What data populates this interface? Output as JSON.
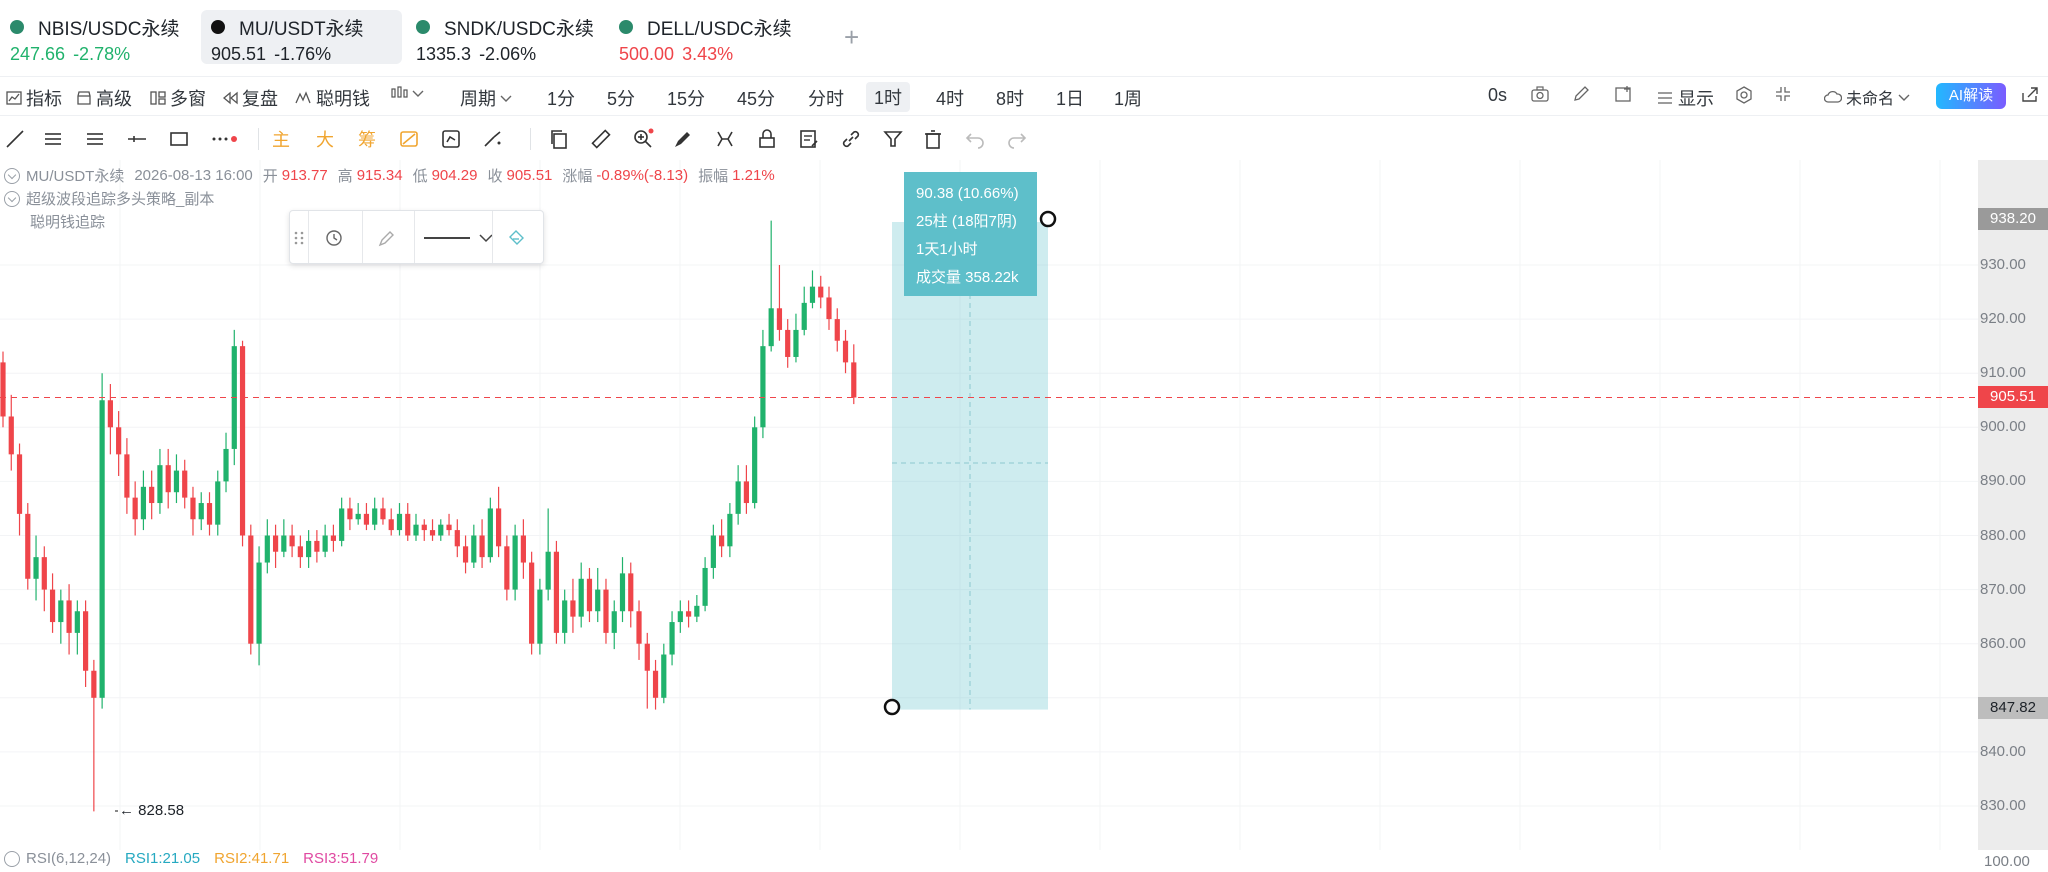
{
  "tabs": [
    {
      "symbol": "NBIS/USDC永续",
      "price": "247.66",
      "change": "-2.78%",
      "price_color": "up",
      "change_color": "up"
    },
    {
      "symbol": "MU/USDT永续",
      "price": "905.51",
      "change": "-1.76%",
      "price_color": "dark",
      "change_color": "dark"
    },
    {
      "symbol": "SNDK/USDC永续",
      "price": "1335.3",
      "change": "-2.06%",
      "price_color": "dark",
      "change_color": "dark"
    },
    {
      "symbol": "DELL/USDC永续",
      "price": "500.00",
      "change": "3.43%",
      "price_color": "down",
      "change_color": "down"
    }
  ],
  "add_tab_label": "+",
  "toolbar": {
    "indicators": "指标",
    "advanced": "高级",
    "multi_window": "多窗",
    "replay": "复盘",
    "smart_money": "聪明钱",
    "period": "周期",
    "intervals": [
      "1分",
      "5分",
      "15分",
      "45分",
      "分时",
      "1时",
      "4时",
      "8时",
      "1日",
      "1周"
    ],
    "selected_interval": "1时",
    "timer": "0s",
    "display": "显示",
    "layout_name": "未命名",
    "ai_label": "AI解读"
  },
  "legend": {
    "symbol": "MU/USDT永续",
    "datetime": "2026-08-13 16:00",
    "open_label": "开",
    "open": "913.77",
    "high_label": "高",
    "high": "915.34",
    "low_label": "低",
    "low": "904.29",
    "close_label": "收",
    "close": "905.51",
    "change_label": "涨幅",
    "change": "-0.89%(-8.13)",
    "amplitude_label": "振幅",
    "amplitude": "1.21%",
    "strategy": "超级波段追踪多头策略_副本",
    "indicator2": "聪明钱追踪"
  },
  "price_axis": {
    "labels": [
      "930.00",
      "920.00",
      "910.00",
      "900.00",
      "890.00",
      "880.00",
      "870.00",
      "860.00",
      "840.00",
      "830.00"
    ],
    "top_tag": "938.20",
    "current_tag": "905.51",
    "bottom_tag": "847.82",
    "rsi_scale": "100.00"
  },
  "measure": {
    "line1": "90.38 (10.66%)",
    "line2": "25柱 (18阳7阴)",
    "line3": "1天1小时",
    "line4": "成交量 358.22k"
  },
  "low_marker": "← 828.58",
  "rsi": {
    "name": "RSI(6,12,24)",
    "rsi1": "RSI1:21.05",
    "rsi2": "RSI2:41.71",
    "rsi3": "RSI3:51.79"
  },
  "colors": {
    "up": "#20b26c",
    "down": "#ef454a",
    "measure": "#5ebfca",
    "accent": "#f0a530"
  },
  "chart_data": {
    "type": "candlestick",
    "interval": "1时",
    "y_range": [
      825,
      945
    ],
    "current_price": 905.51,
    "measure_range": {
      "from": 847.82,
      "to": 938.2
    },
    "candles": [
      [
        912,
        902,
        914,
        900
      ],
      [
        902,
        895,
        906,
        892
      ],
      [
        895,
        884,
        897,
        880
      ],
      [
        884,
        872,
        886,
        870
      ],
      [
        872,
        876,
        880,
        868
      ],
      [
        876,
        870,
        878,
        866
      ],
      [
        870,
        864,
        873,
        862
      ],
      [
        864,
        868,
        870,
        860
      ],
      [
        868,
        862,
        871,
        858
      ],
      [
        862,
        866,
        868,
        858
      ],
      [
        866,
        855,
        868,
        852
      ],
      [
        855,
        850,
        857,
        829
      ],
      [
        850,
        905,
        910,
        848
      ],
      [
        905,
        900,
        908,
        895
      ],
      [
        900,
        895,
        903,
        891
      ],
      [
        895,
        887,
        898,
        884
      ],
      [
        887,
        883,
        890,
        880
      ],
      [
        883,
        889,
        892,
        881
      ],
      [
        889,
        886,
        892,
        883
      ],
      [
        886,
        893,
        896,
        884
      ],
      [
        893,
        888,
        896,
        885
      ],
      [
        888,
        892,
        895,
        886
      ],
      [
        892,
        887,
        894,
        885
      ],
      [
        887,
        883,
        889,
        880
      ],
      [
        883,
        886,
        888,
        881
      ],
      [
        886,
        882,
        888,
        880
      ],
      [
        882,
        890,
        892,
        880
      ],
      [
        890,
        896,
        899,
        888
      ],
      [
        896,
        915,
        918,
        893
      ],
      [
        915,
        880,
        916,
        878
      ],
      [
        880,
        860,
        882,
        858
      ],
      [
        860,
        875,
        878,
        856
      ],
      [
        875,
        880,
        883,
        873
      ],
      [
        880,
        877,
        882,
        874
      ],
      [
        877,
        880,
        883,
        876
      ],
      [
        880,
        878,
        882,
        876
      ],
      [
        878,
        876,
        880,
        874
      ],
      [
        876,
        879,
        881,
        874
      ],
      [
        879,
        877,
        881,
        875
      ],
      [
        877,
        880,
        882,
        876
      ],
      [
        880,
        879,
        882,
        877
      ],
      [
        879,
        885,
        887,
        878
      ],
      [
        885,
        883,
        887,
        881
      ],
      [
        883,
        884,
        886,
        882
      ],
      [
        884,
        882,
        886,
        881
      ],
      [
        882,
        885,
        887,
        881
      ],
      [
        885,
        883,
        887,
        882
      ],
      [
        883,
        881,
        885,
        880
      ],
      [
        881,
        884,
        886,
        880
      ],
      [
        884,
        880,
        886,
        879
      ],
      [
        880,
        882,
        884,
        879
      ],
      [
        882,
        881,
        883,
        879
      ],
      [
        881,
        880,
        883,
        879
      ],
      [
        880,
        882,
        883,
        879
      ],
      [
        882,
        881,
        884,
        880
      ],
      [
        881,
        878,
        883,
        876
      ],
      [
        878,
        875,
        880,
        873
      ],
      [
        875,
        880,
        882,
        874
      ],
      [
        880,
        876,
        883,
        874
      ],
      [
        876,
        885,
        887,
        875
      ],
      [
        885,
        878,
        889,
        876
      ],
      [
        878,
        870,
        880,
        868
      ],
      [
        870,
        880,
        882,
        868
      ],
      [
        880,
        875,
        883,
        872
      ],
      [
        875,
        860,
        877,
        858
      ],
      [
        860,
        870,
        872,
        858
      ],
      [
        870,
        877,
        885,
        868
      ],
      [
        877,
        862,
        879,
        860
      ],
      [
        862,
        868,
        870,
        860
      ],
      [
        868,
        865,
        872,
        862
      ],
      [
        865,
        872,
        875,
        863
      ],
      [
        872,
        866,
        874,
        864
      ],
      [
        866,
        870,
        874,
        864
      ],
      [
        870,
        862,
        872,
        860
      ],
      [
        862,
        866,
        868,
        859
      ],
      [
        866,
        873,
        876,
        864
      ],
      [
        873,
        866,
        875,
        863
      ],
      [
        866,
        860,
        868,
        857
      ],
      [
        860,
        855,
        862,
        848
      ],
      [
        855,
        850,
        857,
        847.82
      ],
      [
        850,
        858,
        860,
        849
      ],
      [
        858,
        864,
        866,
        856
      ],
      [
        864,
        866,
        868,
        862
      ],
      [
        866,
        865,
        868,
        863
      ],
      [
        865,
        867,
        869,
        864
      ],
      [
        867,
        874,
        876,
        866
      ],
      [
        874,
        880,
        882,
        872
      ],
      [
        880,
        878,
        883,
        876
      ],
      [
        878,
        884,
        886,
        876
      ],
      [
        884,
        890,
        893,
        882
      ],
      [
        890,
        886,
        893,
        884
      ],
      [
        886,
        900,
        902,
        885
      ],
      [
        900,
        915,
        918,
        898
      ],
      [
        915,
        922,
        938.2,
        914
      ],
      [
        922,
        918,
        930,
        916
      ],
      [
        918,
        913,
        920,
        911
      ],
      [
        913,
        918,
        921,
        912
      ],
      [
        918,
        923,
        926,
        917
      ],
      [
        923,
        926,
        929,
        922
      ],
      [
        926,
        924,
        928,
        922
      ],
      [
        924,
        920,
        926,
        918
      ],
      [
        920,
        916,
        922,
        914
      ],
      [
        916,
        912,
        918,
        910
      ],
      [
        912,
        905.51,
        915.34,
        904.29
      ]
    ]
  }
}
